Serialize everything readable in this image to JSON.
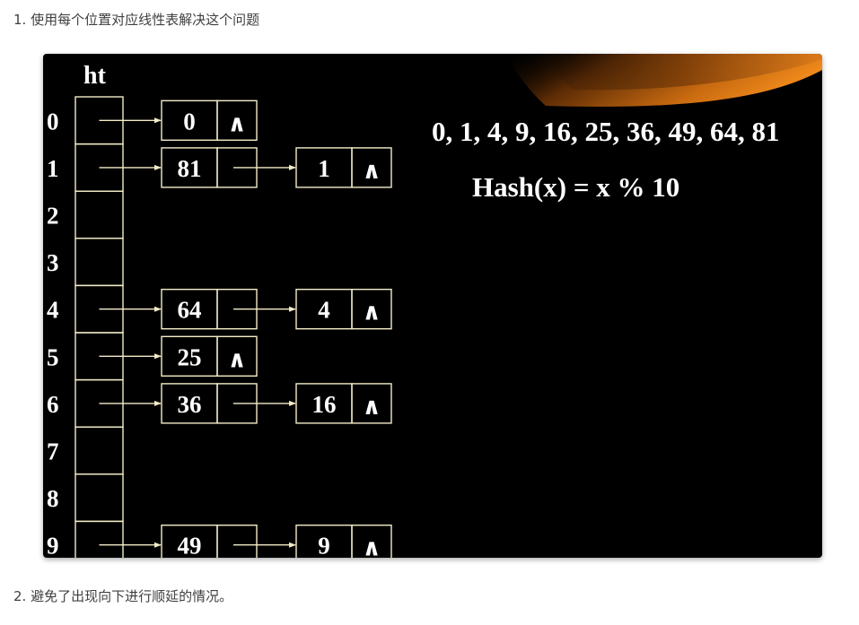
{
  "intro_text": "1. 使用每个位置对应线性表解决这个问题",
  "closing_text": "2. 避免了出现向下进行顺延的情况。",
  "slide": {
    "table_label": "ht",
    "sequence": "0, 1, 4, 9, 16, 25, 36, 49, 64, 81",
    "hash_formula": "Hash(x) = x % 10",
    "null_symbol": "∧",
    "colors": {
      "background": "#000000",
      "lines": "#f3ecc8",
      "text": "#ffffff",
      "accent_orange": "#c86a10"
    },
    "rows": [
      {
        "index": "0",
        "nodes": [
          "0"
        ]
      },
      {
        "index": "1",
        "nodes": [
          "81",
          "1"
        ]
      },
      {
        "index": "2",
        "nodes": []
      },
      {
        "index": "3",
        "nodes": []
      },
      {
        "index": "4",
        "nodes": [
          "64",
          "4"
        ]
      },
      {
        "index": "5",
        "nodes": [
          "25"
        ]
      },
      {
        "index": "6",
        "nodes": [
          "36",
          "16"
        ]
      },
      {
        "index": "7",
        "nodes": []
      },
      {
        "index": "8",
        "nodes": []
      },
      {
        "index": "9",
        "nodes": [
          "49",
          "9"
        ]
      }
    ]
  }
}
